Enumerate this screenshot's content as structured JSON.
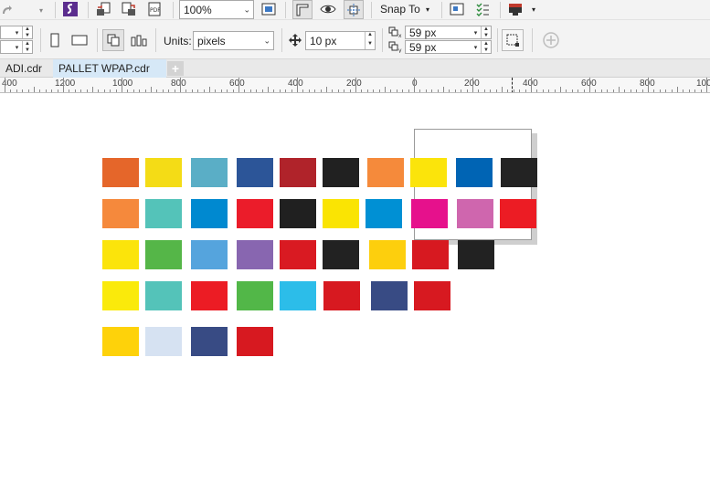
{
  "toolbar": {
    "zoom_value": "100%",
    "snap_label": "Snap To",
    "units_label": "Units:",
    "units_value": "pixels",
    "nudge_value": "10 px",
    "dup_x_value": "59 px",
    "dup_y_value": "59 px",
    "icons": [
      "redo-icon",
      "redo-dropdown-icon",
      "app-launcher-icon",
      "import-icon",
      "export-icon",
      "publish-pdf-icon",
      "zoom-dropdown-icon",
      "fit-page-icon",
      "rulers-icon",
      "view-eye-icon",
      "guidelines-icon",
      "snap-dropdown-icon",
      "options-icon",
      "checklist-icon",
      "launch-icon",
      "launch-dropdown-icon",
      "portrait-icon",
      "landscape-icon",
      "all-pages-icon",
      "current-page-icon",
      "nudge-icon",
      "dup-x-icon",
      "dup-y-icon",
      "selection-icon",
      "add-icon"
    ]
  },
  "tabs": [
    {
      "label": "ADI.cdr",
      "active": false
    },
    {
      "label": "PALLET  WPAP.cdr",
      "active": true
    }
  ],
  "ruler": {
    "ticks": [
      {
        "label": "400"
      },
      {
        "label": "1200"
      },
      {
        "label": "1000"
      },
      {
        "label": "800"
      },
      {
        "label": "600"
      },
      {
        "label": "400"
      },
      {
        "label": "200"
      },
      {
        "label": "0"
      },
      {
        "label": "200"
      },
      {
        "label": "400"
      },
      {
        "label": "600"
      },
      {
        "label": "800"
      },
      {
        "label": "100"
      }
    ]
  },
  "swatches": {
    "row1": [
      "#e5662a",
      "#f4dc16",
      "#5aaec6",
      "#2c5598",
      "#b0232a",
      "#212121",
      "#f58a3b",
      "#fbe40b",
      "#0064b4",
      "#232323"
    ],
    "row2": [
      "#f5893c",
      "#54c3b9",
      "#0089d0",
      "#eb1c2a",
      "#202020",
      "#fae403",
      "#0090d4",
      "#e6118c",
      "#cf66ae",
      "#ec1c24"
    ],
    "row3": [
      "#fbe40b",
      "#55b648",
      "#55a4dd",
      "#8866b0",
      "#d91a22",
      "#222222",
      "#fdcf0d",
      "#d71920",
      "#222222"
    ],
    "row4": [
      "#faea0b",
      "#54c3b9",
      "#ec1c24",
      "#52b748",
      "#2cbde9",
      "#d71920",
      "#384b84",
      "#d71920"
    ],
    "row5": [
      "#fed20a",
      "#d6e2f2",
      "#384b84",
      "#d71920"
    ]
  }
}
